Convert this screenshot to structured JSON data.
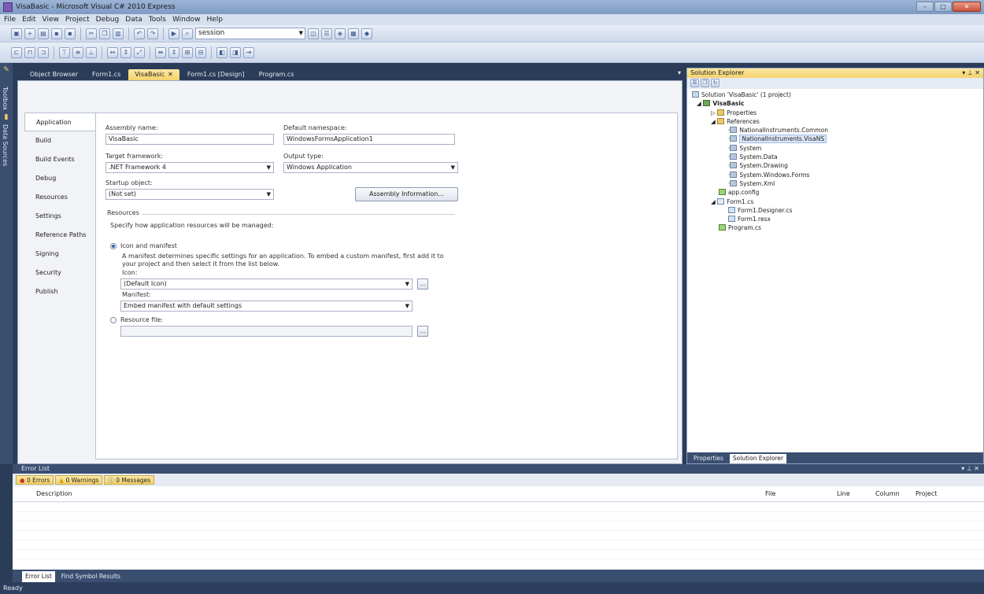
{
  "window": {
    "title": "VisaBasic - Microsoft Visual C# 2010 Express",
    "min": "–",
    "max": "□",
    "close": "✕"
  },
  "menu": [
    "File",
    "Edit",
    "View",
    "Project",
    "Debug",
    "Data",
    "Tools",
    "Window",
    "Help"
  ],
  "toolbar": {
    "config_combo": "session"
  },
  "left_strip": {
    "toolbox": "Toolbox",
    "data_sources": "Data Sources"
  },
  "doc_tabs": [
    {
      "label": "Object Browser"
    },
    {
      "label": "Form1.cs"
    },
    {
      "label": "VisaBasic"
    },
    {
      "label": "Form1.cs [Design]"
    },
    {
      "label": "Program.cs"
    }
  ],
  "doc_close": "✕",
  "doc_dropdown": "▾",
  "project_tabs": [
    "Application",
    "Build",
    "Build Events",
    "Debug",
    "Resources",
    "Settings",
    "Reference Paths",
    "Signing",
    "Security",
    "Publish"
  ],
  "app": {
    "assembly_name_label": "Assembly name:",
    "assembly_name": "VisaBasic",
    "default_ns_label": "Default namespace:",
    "default_ns": "WindowsFormsApplication1",
    "target_fw_label": "Target framework:",
    "target_fw": ".NET Framework 4",
    "output_type_label": "Output type:",
    "output_type": "Windows Application",
    "startup_label": "Startup object:",
    "startup": "(Not set)",
    "assembly_info_btn": "Assembly Information...",
    "resources_heading": "Resources",
    "resources_desc": "Specify how application resources will be managed:",
    "icon_manifest_label": "Icon and manifest",
    "icon_manifest_desc1": "A manifest determines specific settings for an application. To embed a custom manifest, first add it to",
    "icon_manifest_desc2": "your project and then select it from the list below.",
    "icon_label": "Icon:",
    "icon_value": "(Default Icon)",
    "manifest_label": "Manifest:",
    "manifest_value": "Embed manifest with default settings",
    "resource_file_label": "Resource file:",
    "browse": "..."
  },
  "solution_explorer": {
    "title": "Solution Explorer",
    "controls": "▾ ⊥ ✕",
    "tree": [
      {
        "label": "Solution 'VisaBasic' (1 project)",
        "indent": 0
      },
      {
        "label": "VisaBasic",
        "indent": 1,
        "bold": true
      },
      {
        "label": "Properties",
        "indent": 2
      },
      {
        "label": "References",
        "indent": 2
      },
      {
        "label": "NationalInstruments.Common",
        "indent": 3
      },
      {
        "label": "NationalInstruments.VisaNS",
        "indent": 3,
        "selected": true
      },
      {
        "label": "System",
        "indent": 3
      },
      {
        "label": "System.Data",
        "indent": 3
      },
      {
        "label": "System.Drawing",
        "indent": 3
      },
      {
        "label": "System.Windows.Forms",
        "indent": 3
      },
      {
        "label": "System.Xml",
        "indent": 3
      },
      {
        "label": "app.config",
        "indent": 2
      },
      {
        "label": "Form1.cs",
        "indent": 2
      },
      {
        "label": "Form1.Designer.cs",
        "indent": 3
      },
      {
        "label": "Form1.resx",
        "indent": 3
      },
      {
        "label": "Program.cs",
        "indent": 2
      }
    ],
    "bottom_tabs": [
      "Properties",
      "Solution Explorer"
    ]
  },
  "error_list": {
    "title": "Error List",
    "controls": "▾ ⊥ ✕",
    "errors": "0 Errors",
    "warnings": "0 Warnings",
    "messages": "0 Messages",
    "columns": [
      "Description",
      "File",
      "Line",
      "Column",
      "Project"
    ],
    "bottom_tabs": [
      "Error List",
      "Find Symbol Results"
    ]
  },
  "status": "Ready",
  "colors": {
    "accent_tab": "#f4d36d",
    "chrome": "#2b3c59"
  }
}
